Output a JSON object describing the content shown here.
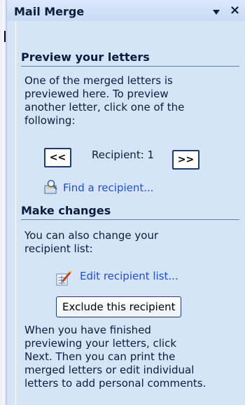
{
  "pane": {
    "title": "Mail Merge"
  },
  "preview": {
    "heading": "Preview your letters",
    "description_lines": [
      "One of the merged letters is",
      "previewed here. To preview",
      "another letter, click one of the",
      "following:"
    ],
    "prev_label": "<<",
    "next_label": ">>",
    "recipient_label": "Recipient: 1",
    "find_link": "Find a recipient..."
  },
  "changes": {
    "heading": "Make changes",
    "description_lines": [
      "You can also change your",
      "recipient list:"
    ],
    "edit_link": "Edit recipient list...",
    "exclude_button": "Exclude this recipient",
    "footer_lines": [
      "When you have finished",
      "previewing your letters, click",
      "Next. Then you can print the",
      "merged letters or edit individual",
      "letters to add personal comments."
    ]
  },
  "icons": [
    "menu-arrow-icon",
    "close-icon",
    "find-recipient-icon",
    "edit-list-icon"
  ]
}
